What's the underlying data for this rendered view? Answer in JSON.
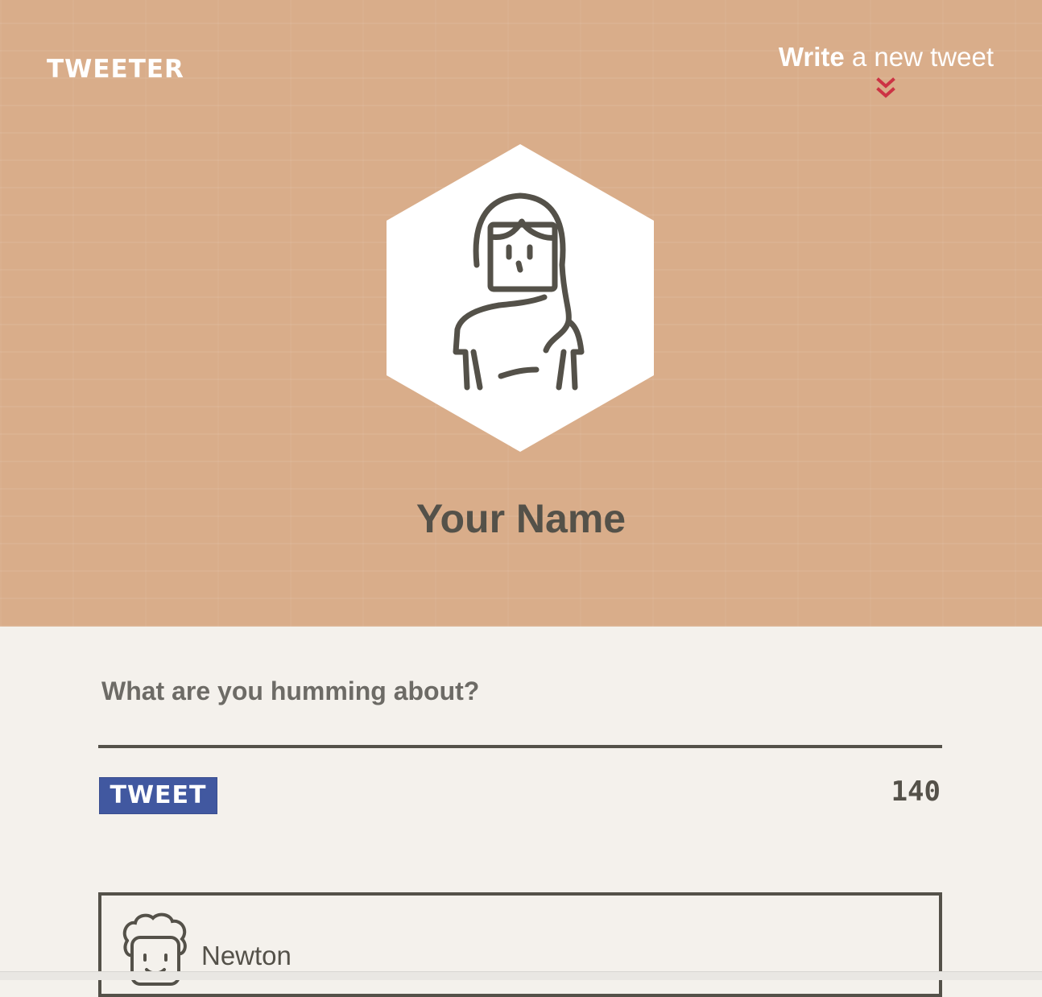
{
  "header": {
    "logo": "TWEETER",
    "compose_link": {
      "bold": "Write",
      "rest": " a new tweet"
    },
    "chevron_icon": "double-chevron-down-icon",
    "chevron_color": "#cc3344"
  },
  "profile": {
    "avatar_icon": "user-avatar-icon",
    "name": "Your Name"
  },
  "composer": {
    "prompt": "What are you humming about?",
    "button_label": "TWEET",
    "char_count": "140"
  },
  "feed": {
    "items": [
      {
        "avatar_icon": "user-avatar-icon",
        "name": "Newton"
      }
    ]
  },
  "colors": {
    "hero_bg": "#d9ad8a",
    "page_bg": "#f4f1ec",
    "text_dark": "#545149",
    "button_bg": "#4158a0"
  }
}
